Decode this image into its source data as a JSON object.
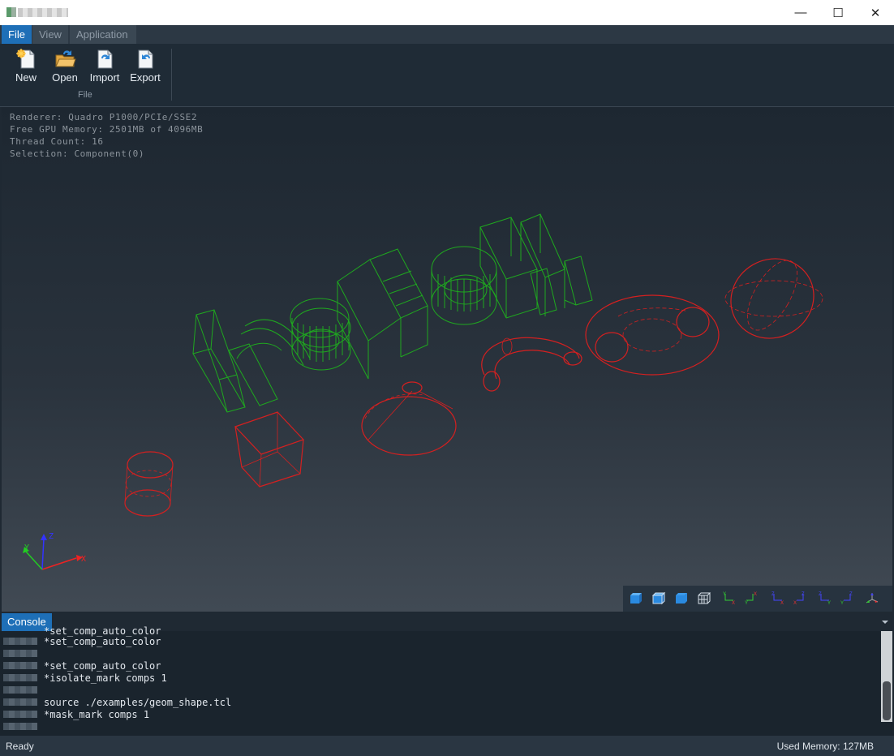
{
  "window": {
    "minimize_glyph": "—",
    "maximize_glyph": "☐",
    "close_glyph": "✕"
  },
  "menu": {
    "items": [
      "File",
      "View",
      "Application"
    ]
  },
  "ribbon": {
    "buttons": [
      {
        "label": "New",
        "icon": "new-file-icon"
      },
      {
        "label": "Open",
        "icon": "open-folder-icon"
      },
      {
        "label": "Import",
        "icon": "import-icon"
      },
      {
        "label": "Export",
        "icon": "export-icon"
      }
    ],
    "group_label": "File"
  },
  "viewport": {
    "info": [
      "Renderer: Quadro P1000/PCIe/SSE2",
      "Free GPU Memory: 2501MB of 4096MB",
      "Thread Count: 16",
      "Selection: Component(0)"
    ],
    "axis_labels": {
      "x": "X",
      "y": "Y",
      "z": "Z"
    },
    "colors": {
      "selected_wire": "#1fa81f",
      "wire": "#d42020",
      "axis_x": "#e22",
      "axis_y": "#2c2",
      "axis_z": "#33f"
    }
  },
  "console": {
    "tab_label": "Console",
    "lines": [
      "*set_comp_auto_color",
      "*set_comp_auto_color",
      "",
      "*set_comp_auto_color",
      "*isolate_mark comps 1",
      "",
      "source ./examples/geom_shape.tcl",
      "*mask_mark comps 1"
    ]
  },
  "status": {
    "left": "Ready",
    "right": "Used Memory: 127MB"
  }
}
